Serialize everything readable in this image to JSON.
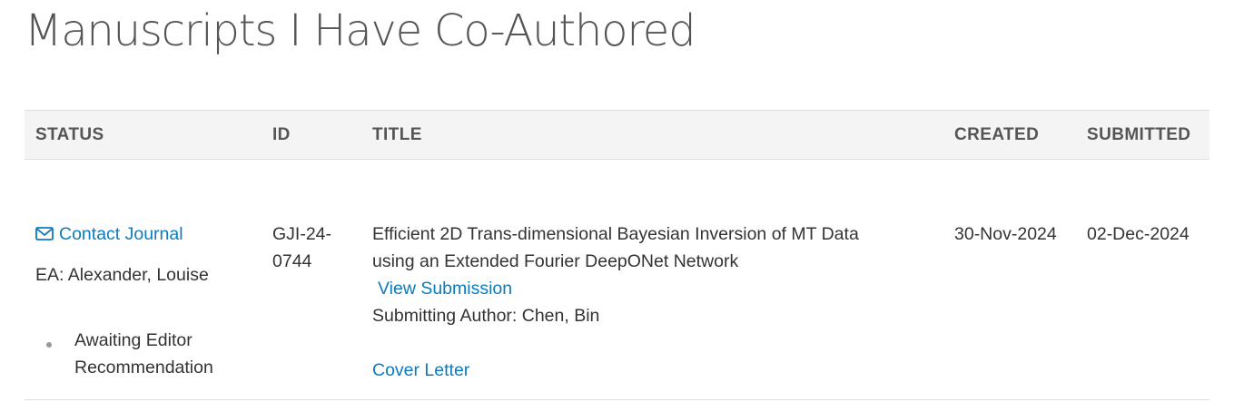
{
  "page": {
    "title": "Manuscripts I Have Co-Authored"
  },
  "table": {
    "headers": {
      "status": "STATUS",
      "id": "ID",
      "title": "TITLE",
      "created": "CREATED",
      "submitted": "SUBMITTED"
    },
    "rows": [
      {
        "contact_label": "Contact Journal",
        "ea": "EA: Alexander, Louise",
        "status_line1": "Awaiting Editor",
        "status_line2": "Recommendation",
        "id_line1": "GJI-24-",
        "id_line2": "0744",
        "title_line1": "Efficient 2D Trans-dimensional Bayesian Inversion of MT Data",
        "title_line2": "using an Extended Fourier DeepONet Network",
        "view_submission": "View Submission",
        "submitting_author": "Submitting Author: Chen, Bin",
        "cover_letter": "Cover Letter",
        "created": "30-Nov-2024",
        "submitted": "02-Dec-2024"
      }
    ]
  },
  "icons": {
    "contact": "envelope-icon",
    "status_bullet": "bullet-icon"
  },
  "colors": {
    "link": "#0d7bbd",
    "header_bg": "#f4f4f4",
    "title_text": "#555555",
    "body_text": "#333333"
  }
}
